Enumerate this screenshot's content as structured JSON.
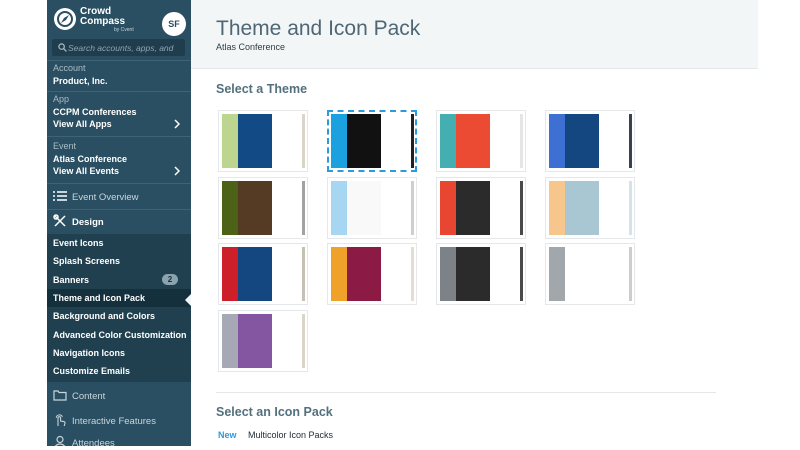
{
  "brand": {
    "name_line1": "Crowd",
    "name_line2": "Compass",
    "by_line": "by Cvent"
  },
  "user": {
    "initials": "SF"
  },
  "search": {
    "placeholder": "Search accounts, apps, and"
  },
  "context": {
    "account_label": "Account",
    "account_value": "Product, Inc.",
    "app_label": "App",
    "app_value": "CCPM Conferences",
    "app_link": "View All Apps",
    "event_label": "Event",
    "event_value": "Atlas Conference",
    "event_link": "View All Events"
  },
  "nav": {
    "event_overview": "Event Overview",
    "design": "Design",
    "design_items": [
      {
        "label": "Event Icons"
      },
      {
        "label": "Splash Screens"
      },
      {
        "label": "Banners",
        "badge": "2"
      },
      {
        "label": "Theme and Icon Pack"
      },
      {
        "label": "Background and Colors"
      },
      {
        "label": "Advanced Color Customization"
      },
      {
        "label": "Navigation Icons"
      },
      {
        "label": "Customize Emails"
      }
    ],
    "content": "Content",
    "interactive": "Interactive Features",
    "attendees": "Attendees"
  },
  "header": {
    "title": "Theme and Icon Pack",
    "subtitle": "Atlas Conference"
  },
  "themes": {
    "section_title": "Select a Theme",
    "selected_index": 1,
    "items": [
      {
        "colors": [
          "#bcd58f",
          "#124a86",
          "#ffffff",
          "#d9d5c8"
        ]
      },
      {
        "colors": [
          "#1ba1e0",
          "#111111",
          "#ffffff",
          "#222222"
        ]
      },
      {
        "colors": [
          "#45aeb1",
          "#ec4b33",
          "#ffffff",
          "#e5e5e5"
        ]
      },
      {
        "colors": [
          "#3e6fd3",
          "#144780",
          "#ffffff",
          "#3a4150"
        ]
      },
      {
        "colors": [
          "#4c6216",
          "#553b23",
          "#ffffff",
          "#a3a3a3"
        ]
      },
      {
        "colors": [
          "#a7d6f3",
          "#f9f9f9",
          "#ffffff",
          "#cfcfcf"
        ]
      },
      {
        "colors": [
          "#e94632",
          "#2b2b2b",
          "#ffffff",
          "#4a4a4a"
        ]
      },
      {
        "colors": [
          "#f7c68c",
          "#a8c7d3",
          "#ffffff",
          "#d3e3ea"
        ]
      },
      {
        "colors": [
          "#cc1f2a",
          "#144780",
          "#ffffff",
          "#c6c1b5"
        ]
      },
      {
        "colors": [
          "#f0a12a",
          "#8b1b45",
          "#ffffff",
          "#e2ded6"
        ]
      },
      {
        "colors": [
          "#7c8288",
          "#2b2b2b",
          "#ffffff",
          "#4a4a4a"
        ]
      },
      {
        "colors": [
          "#a2a7ab",
          "#ffffff",
          "#ffffff",
          "#cdcdcd"
        ]
      },
      {
        "colors": [
          "#a6a8b6",
          "#8455a0",
          "#ffffff",
          "#d9d5c8"
        ]
      }
    ]
  },
  "icon_pack": {
    "section_title": "Select an Icon Pack",
    "new_tag": "New",
    "first_pack": "Multicolor Icon Packs"
  }
}
